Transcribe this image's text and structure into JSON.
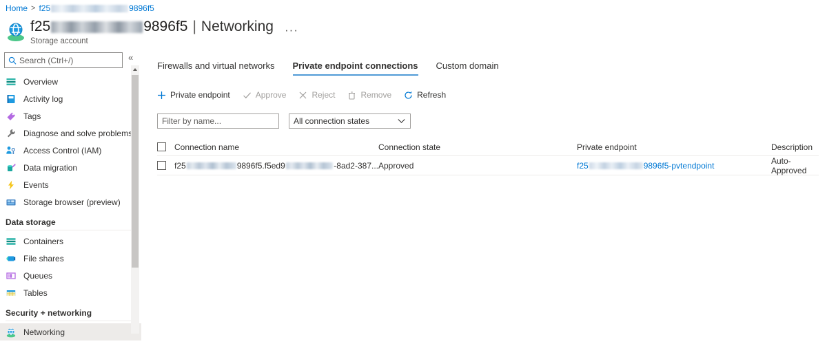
{
  "breadcrumb": {
    "home": "Home",
    "separator": ">",
    "resource_prefix": "f25",
    "resource_suffix": "9896f5"
  },
  "header": {
    "title_prefix": "f25",
    "title_suffix": "9896f5",
    "separator": "|",
    "section": "Networking",
    "subtitle": "Storage account",
    "more_menu": "···",
    "resource_icon": "storage-account-icon"
  },
  "sidebar": {
    "search": {
      "placeholder": "Search (Ctrl+/)",
      "value": "",
      "icon": "search-icon"
    },
    "collapse": "«",
    "items": [
      {
        "label": "Overview",
        "icon": "overview-icon",
        "selected": false
      },
      {
        "label": "Activity log",
        "icon": "activity-log-icon",
        "selected": false
      },
      {
        "label": "Tags",
        "icon": "tags-icon",
        "selected": false
      },
      {
        "label": "Diagnose and solve problems",
        "icon": "diagnose-icon",
        "selected": false
      },
      {
        "label": "Access Control (IAM)",
        "icon": "access-control-icon",
        "selected": false
      },
      {
        "label": "Data migration",
        "icon": "data-migration-icon",
        "selected": false
      },
      {
        "label": "Events",
        "icon": "events-icon",
        "selected": false
      },
      {
        "label": "Storage browser (preview)",
        "icon": "storage-browser-icon",
        "selected": false
      }
    ],
    "groups": [
      {
        "title": "Data storage",
        "items": [
          {
            "label": "Containers",
            "icon": "containers-icon",
            "selected": false
          },
          {
            "label": "File shares",
            "icon": "file-shares-icon",
            "selected": false
          },
          {
            "label": "Queues",
            "icon": "queues-icon",
            "selected": false
          },
          {
            "label": "Tables",
            "icon": "tables-icon",
            "selected": false
          }
        ]
      },
      {
        "title": "Security + networking",
        "items": [
          {
            "label": "Networking",
            "icon": "networking-icon",
            "selected": true
          }
        ]
      }
    ]
  },
  "tabs": [
    {
      "label": "Firewalls and virtual networks",
      "active": false
    },
    {
      "label": "Private endpoint connections",
      "active": true
    },
    {
      "label": "Custom domain",
      "active": false
    }
  ],
  "toolbar": [
    {
      "label": "Private endpoint",
      "icon": "plus-icon",
      "disabled": false
    },
    {
      "label": "Approve",
      "icon": "check-icon",
      "disabled": true
    },
    {
      "label": "Reject",
      "icon": "x-icon",
      "disabled": true
    },
    {
      "label": "Remove",
      "icon": "trash-icon",
      "disabled": true
    },
    {
      "label": "Refresh",
      "icon": "refresh-icon",
      "disabled": false
    }
  ],
  "filters": {
    "name_placeholder": "Filter by name...",
    "name_value": "",
    "state_selected": "All connection states",
    "state_chevron": "chevron-down-icon"
  },
  "table": {
    "columns": [
      "Connection name",
      "Connection state",
      "Private endpoint",
      "Description"
    ],
    "rows": [
      {
        "connection_name_prefix": "f25",
        "connection_name_mid": "9896f5.f5ed9",
        "connection_name_suffix": "-8ad2-387...",
        "connection_state": "Approved",
        "private_endpoint_prefix": "f25",
        "private_endpoint_suffix": "9896f5-pvtendpoint",
        "description": "Auto-Approved"
      }
    ]
  },
  "colors": {
    "accent": "#0078d4",
    "tab_underline": "#4f9ad6",
    "selected_row": "#edebe9",
    "border": "#edebe9"
  }
}
